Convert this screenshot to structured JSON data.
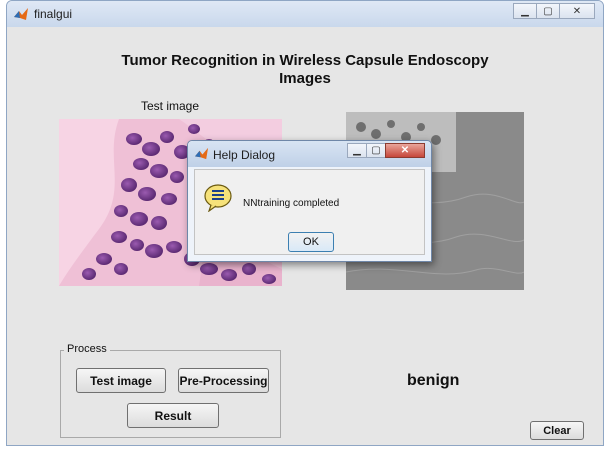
{
  "window": {
    "title": "finalgui",
    "controls": [
      "minimize",
      "restore",
      "close"
    ]
  },
  "gui": {
    "title_line1": "Tumor Recognition in Wireless Capsule Endoscopy",
    "title_line2": "Images",
    "test_image_label": "Test image",
    "process_group_label": "Process",
    "buttons": {
      "test_image": "Test image",
      "pre_processing": "Pre-Processing",
      "result": "Result",
      "clear": "Clear"
    },
    "result_text": "benign"
  },
  "dialog": {
    "title": "Help Dialog",
    "message": "NNtraining completed",
    "ok_label": "OK"
  },
  "icons": {
    "app": "matlab-icon",
    "dialog_info": "help-info-icon"
  },
  "colors": {
    "window_bg": "#e6e6e6",
    "image_tissue": "#e8a6c7",
    "image_nuclei": "#7a3f90",
    "edge_image_bg": "#8a8a8a"
  }
}
